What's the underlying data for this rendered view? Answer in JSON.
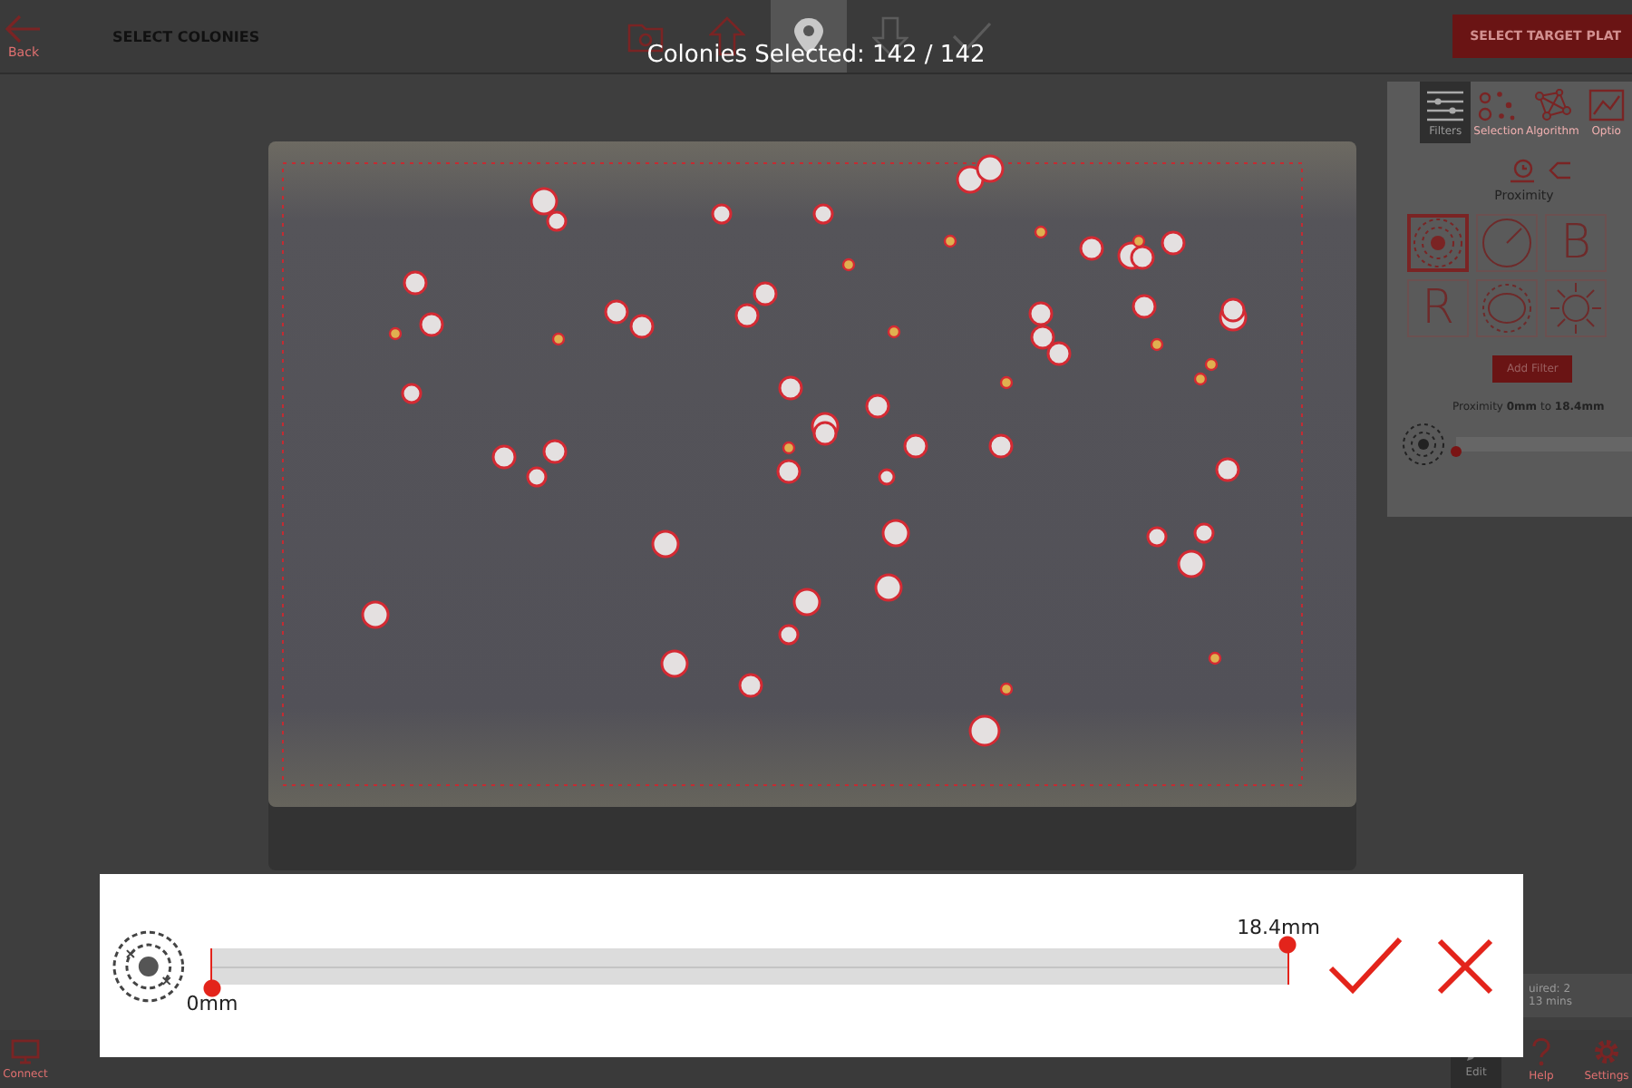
{
  "top_bar": {
    "back_label": "Back",
    "title": "SELECT COLONIES",
    "action": "SELECT TARGET PLAT",
    "steps": [
      {
        "kind": "folder",
        "selected": false
      },
      {
        "kind": "up",
        "selected": false
      },
      {
        "kind": "pin",
        "selected": true
      },
      {
        "kind": "down",
        "selected": false
      },
      {
        "kind": "check",
        "selected": false
      }
    ]
  },
  "selection_count": "Colonies Selected: 142 / 142",
  "side_panel": {
    "tabs": [
      {
        "kind": "filters",
        "label": "Filters",
        "selected": true
      },
      {
        "kind": "selection",
        "label": "Selection",
        "selected": false
      },
      {
        "kind": "algorithm",
        "label": "Algorithm",
        "selected": false
      },
      {
        "kind": "options",
        "label": "Optio",
        "selected": false
      }
    ],
    "heading": "Proximity",
    "tiles": [
      {
        "kind": "proximity",
        "selected": true
      },
      {
        "kind": "gauge",
        "selected": false
      },
      {
        "kind": "letter",
        "glyph": "B",
        "selected": false
      },
      {
        "kind": "letter",
        "glyph": "R",
        "selected": false
      },
      {
        "kind": "ring",
        "selected": false
      },
      {
        "kind": "sun",
        "selected": false
      }
    ],
    "add_button": "Add Filter",
    "range_text": "Proximity **0mm** to **18.4mm**",
    "slider": {
      "level": 0
    }
  },
  "summary": [
    "uired: 2",
    "13 mins"
  ],
  "bottom_bar": [
    {
      "kind": "monitor",
      "label": "Connect",
      "selected": false
    },
    {
      "kind": "edit",
      "label": "Edit",
      "selected": true
    },
    {
      "kind": "help",
      "label": "Help",
      "selected": false
    },
    {
      "kind": "gear",
      "label": "Settings",
      "selected": false
    }
  ],
  "dialog": {
    "max_label": "18.4mm",
    "min_label": "0mm",
    "thumbs": [
      {
        "kind": "min",
        "level": 0
      },
      {
        "kind": "max",
        "level": 1
      }
    ]
  }
}
